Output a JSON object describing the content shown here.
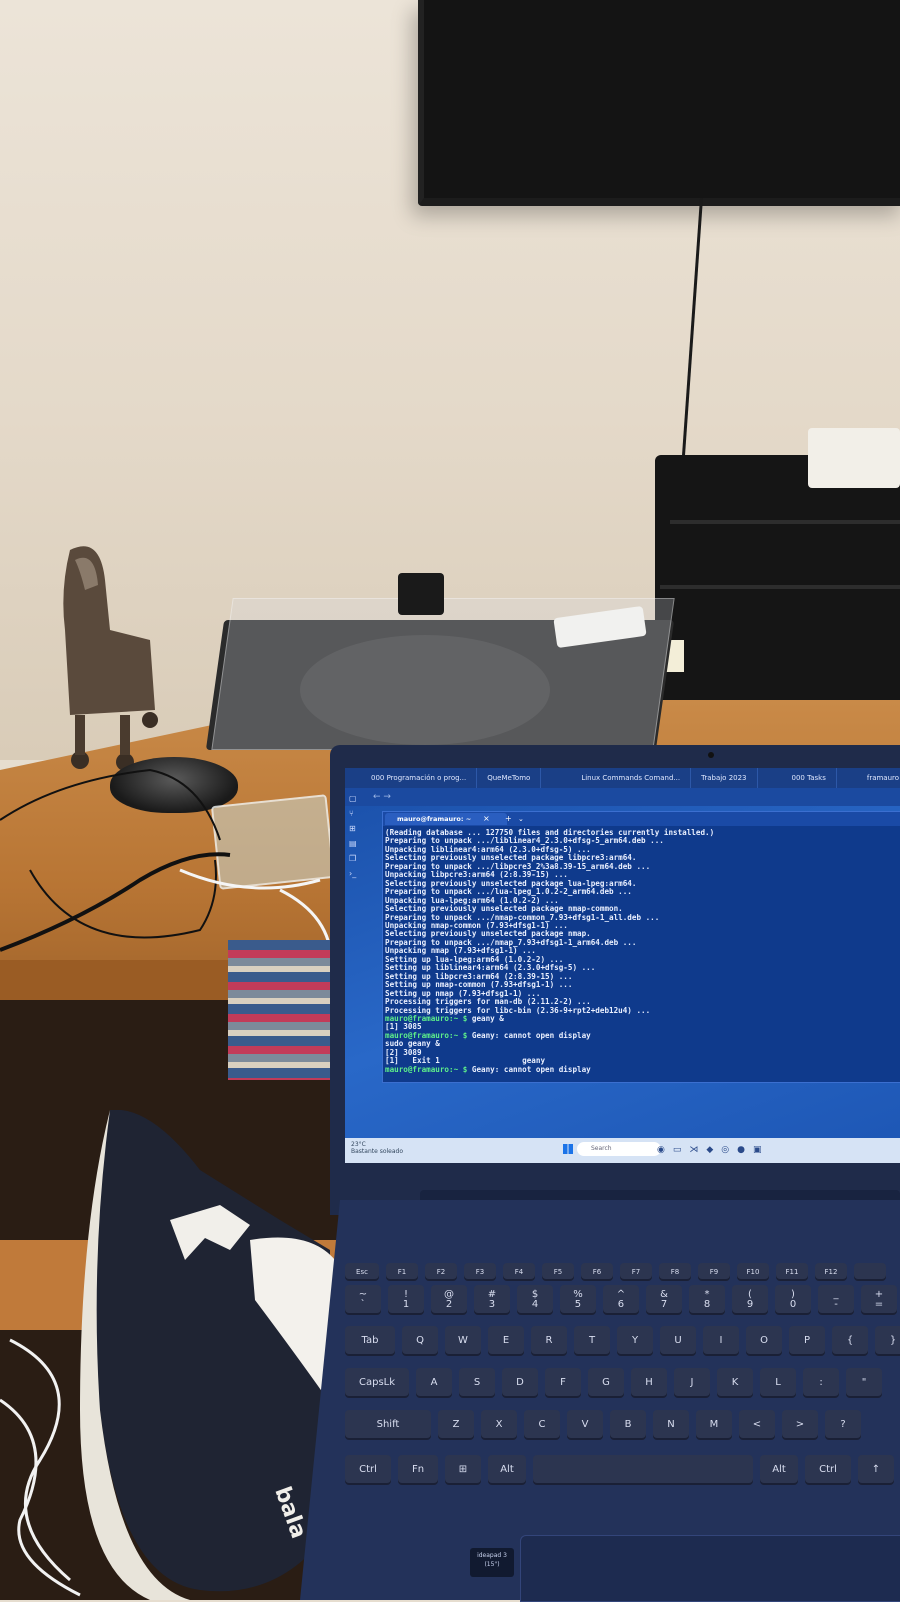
{
  "browser": {
    "tabs": [
      {
        "label": "000 Programación o prog..."
      },
      {
        "label": "QueMeTomo"
      },
      {
        "label": "Linux Commands Comand..."
      },
      {
        "label": "Trabajo 2023"
      },
      {
        "label": "000 Tasks"
      },
      {
        "label": "framauro"
      }
    ]
  },
  "terminal": {
    "tab_title": "mauro@framauro: ~",
    "lines": [
      {
        "text": "(Reading database ... 127750 files and directories currently installed.)",
        "type": "out"
      },
      {
        "text": "Preparing to unpack .../liblinear4_2.3.0+dfsg-5_arm64.deb ...",
        "type": "out"
      },
      {
        "text": "Unpacking liblinear4:arm64 (2.3.0+dfsg-5) ...",
        "type": "out"
      },
      {
        "text": "Selecting previously unselected package libpcre3:arm64.",
        "type": "out"
      },
      {
        "text": "Preparing to unpack .../libpcre3_2%3a8.39-15_arm64.deb ...",
        "type": "out"
      },
      {
        "text": "Unpacking libpcre3:arm64 (2:8.39-15) ...",
        "type": "out"
      },
      {
        "text": "Selecting previously unselected package lua-lpeg:arm64.",
        "type": "out"
      },
      {
        "text": "Preparing to unpack .../lua-lpeg_1.0.2-2_arm64.deb ...",
        "type": "out"
      },
      {
        "text": "Unpacking lua-lpeg:arm64 (1.0.2-2) ...",
        "type": "out"
      },
      {
        "text": "Selecting previously unselected package nmap-common.",
        "type": "out"
      },
      {
        "text": "Preparing to unpack .../nmap-common_7.93+dfsg1-1_all.deb ...",
        "type": "out"
      },
      {
        "text": "Unpacking nmap-common (7.93+dfsg1-1) ...",
        "type": "out"
      },
      {
        "text": "Selecting previously unselected package nmap.",
        "type": "out"
      },
      {
        "text": "Preparing to unpack .../nmap_7.93+dfsg1-1_arm64.deb ...",
        "type": "out"
      },
      {
        "text": "Unpacking nmap (7.93+dfsg1-1) ...",
        "type": "out"
      },
      {
        "text": "Setting up lua-lpeg:arm64 (1.0.2-2) ...",
        "type": "out"
      },
      {
        "text": "Setting up liblinear4:arm64 (2.3.0+dfsg-5) ...",
        "type": "out"
      },
      {
        "text": "Setting up libpcre3:arm64 (2:8.39-15) ...",
        "type": "out"
      },
      {
        "text": "Setting up nmap-common (7.93+dfsg1-1) ...",
        "type": "out"
      },
      {
        "text": "Setting up nmap (7.93+dfsg1-1) ...",
        "type": "out"
      },
      {
        "text": "Processing triggers for man-db (2.11.2-2) ...",
        "type": "out"
      },
      {
        "text": "Processing triggers for libc-bin (2.36-9+rpt2+deb12u4) ...",
        "type": "out"
      },
      {
        "prompt": "mauro@framauro:~ $",
        "text": " geany &",
        "type": "cmd"
      },
      {
        "text": "[1] 3085",
        "type": "out"
      },
      {
        "prompt": "mauro@framauro:~ $",
        "text": " Geany: cannot open display",
        "type": "cmd"
      },
      {
        "text": "sudo geany &",
        "type": "out"
      },
      {
        "text": "[2] 3089",
        "type": "out"
      },
      {
        "text": "[1]   Exit 1                  geany",
        "type": "out"
      },
      {
        "prompt": "mauro@framauro:~ $",
        "text": " Geany: cannot open display",
        "type": "cmd"
      }
    ]
  },
  "taskbar": {
    "weather_temp": "23°C",
    "weather_desc": "Bastante soleado",
    "search_placeholder": "Search"
  },
  "keyboard": {
    "fn_row": [
      "Esc",
      "F1",
      "F2",
      "F3",
      "F4",
      "F5",
      "F6",
      "F7",
      "F8",
      "F9",
      "F10",
      "F11",
      "F12",
      ""
    ],
    "row1": [
      "~\n`",
      "!\n1",
      "@\n2",
      "#\n3",
      "$\n4",
      "%\n5",
      "^\n6",
      "&\n7",
      "*\n8",
      "(\n9",
      ")\n0",
      "_\n-",
      "+\n="
    ],
    "row2": [
      "Tab",
      "Q",
      "W",
      "E",
      "R",
      "T",
      "Y",
      "U",
      "I",
      "O",
      "P",
      "{",
      "}"
    ],
    "row3": [
      "CapsLk",
      "A",
      "S",
      "D",
      "F",
      "G",
      "H",
      "J",
      "K",
      "L",
      ":",
      "\""
    ],
    "row4": [
      "Shift",
      "Z",
      "X",
      "C",
      "V",
      "B",
      "N",
      "M",
      "<",
      ">",
      "?"
    ],
    "row5": [
      "Ctrl",
      "Fn",
      "⊞",
      "Alt",
      "",
      "Alt",
      "Ctrl",
      "↑"
    ],
    "model_badge": "ideapad 3\n(15\")"
  },
  "shoe": {
    "brand_text": "bala"
  },
  "colors": {
    "screen_blue": "#2968c8",
    "prompt_green": "#5ef08a",
    "laptop_body": "#23325a"
  }
}
